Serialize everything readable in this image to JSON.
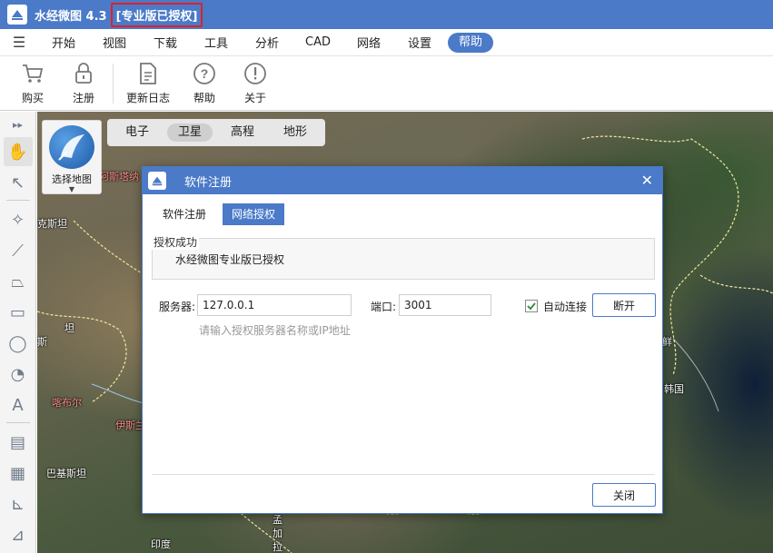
{
  "titlebar": {
    "app_title": "水经微图 4.3",
    "license_badge": "[专业版已授权]"
  },
  "menu": {
    "items": [
      "开始",
      "视图",
      "下载",
      "工具",
      "分析",
      "CAD",
      "网络",
      "设置"
    ],
    "active": "帮助"
  },
  "ribbon": {
    "buttons": [
      {
        "label": "购买",
        "icon": "cart-icon"
      },
      {
        "label": "注册",
        "icon": "lock-icon"
      },
      {
        "label": "更新日志",
        "icon": "document-icon"
      },
      {
        "label": "帮助",
        "icon": "question-icon"
      },
      {
        "label": "关于",
        "icon": "info-icon"
      }
    ]
  },
  "map": {
    "selector_label": "选择地图",
    "types": [
      "电子",
      "卫星",
      "高程",
      "地形"
    ],
    "active_type": "卫星",
    "labels": {
      "kazakh": "克斯坦",
      "turkmen": "坦",
      "afghan": "斯",
      "kabul": "喀布尔",
      "islamabad": "伊斯兰",
      "pakistan": "巴基斯坦",
      "india": "印度",
      "bangla1": "孟",
      "bangla2": "加",
      "bangla3": "拉",
      "korea": "鲜",
      "skorea": "韩国",
      "kazcity": "阿斯塔纳"
    }
  },
  "dialog": {
    "title": "软件注册",
    "tabs": [
      "软件注册",
      "网络授权"
    ],
    "active_tab": "网络授权",
    "group_title": "授权成功",
    "group_text": "水经微图专业版已授权",
    "server_label": "服务器:",
    "server_value": "127.0.0.1",
    "port_label": "端口:",
    "port_value": "3001",
    "auto_connect_label": "自动连接",
    "auto_connect_checked": true,
    "disconnect_button": "断开",
    "hint": "请输入授权服务器名称或IP地址",
    "close_button": "关闭"
  },
  "colors": {
    "accent": "#4a7ac8",
    "license_border": "#e0202a"
  }
}
